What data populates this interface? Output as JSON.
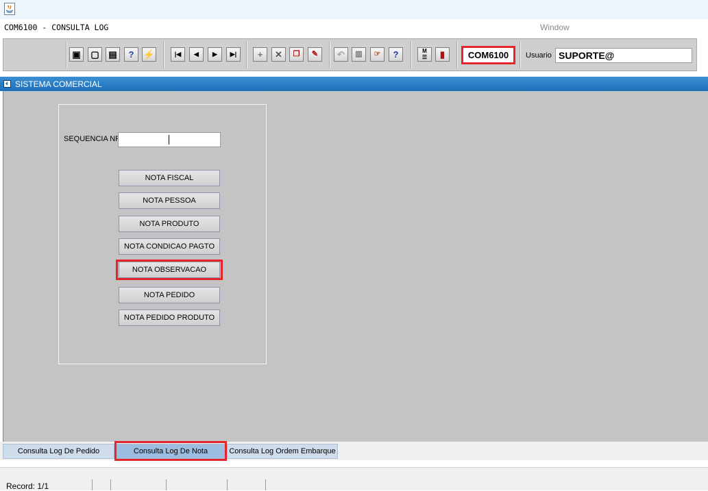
{
  "window": {
    "title": "COM6100 - CONSULTA LOG",
    "menu_window": "Window"
  },
  "toolbar": {
    "groups": [
      [
        "save-icon",
        "enter-query-icon",
        "print-icon",
        "query-help-icon",
        "execute-query-icon"
      ],
      [
        "first-record-icon",
        "previous-record-icon",
        "next-record-icon",
        "last-record-icon"
      ],
      [
        "insert-record-icon",
        "delete-record-icon",
        "duplicate-record-icon",
        "clear-record-icon"
      ],
      [
        "undo-icon",
        "paste-icon",
        "list-values-icon",
        "help-icon"
      ],
      [
        "menu-icon",
        "exit-icon"
      ]
    ],
    "form_code": "COM6100",
    "usuario_label": "Usuario",
    "usuario_value": "SUPORTE@"
  },
  "header": {
    "title": "SISTEMA COMERCIAL"
  },
  "form": {
    "seq_label": "SEQUENCIA NF",
    "seq_value": "",
    "buttons": [
      "NOTA FISCAL",
      "NOTA PESSOA",
      "NOTA PRODUTO",
      "NOTA CONDICAO PAGTO",
      "NOTA OBSERVACAO",
      "NOTA PEDIDO",
      "NOTA PEDIDO PRODUTO"
    ]
  },
  "tabs": [
    "Consulta Log De Pedido",
    "Consulta Log De Nota",
    "Consulta Log Ordem Embarque"
  ],
  "status": {
    "record": "Record: 1/1"
  },
  "colors": {
    "accent_blue": "#1d6fb8",
    "highlight_red": "#e5252b",
    "canvas_gray": "#c4c4c4"
  }
}
